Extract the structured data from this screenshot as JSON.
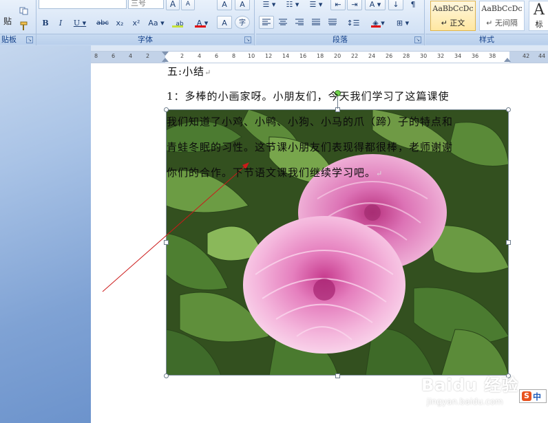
{
  "ribbon": {
    "groups": {
      "clipboard": "贴板",
      "font": "字体",
      "paragraph": "段落",
      "styles": "样式"
    },
    "clipboard": {
      "paste_label": "贴"
    },
    "font": {
      "size_value": "三号",
      "bold": "B",
      "italic": "I",
      "underline": "U",
      "strikethrough": "abc",
      "subscript": "x₂",
      "superscript": "x²",
      "change_case": "Aa",
      "grow_font": "A",
      "shrink_font": "A",
      "clear_format": "A",
      "char_border": "A",
      "phonetic": "ab",
      "font_color": "A",
      "char_shading": "A",
      "enclose_char": "字"
    },
    "styles": [
      {
        "sample": "AaBbCcDc",
        "name": "↵ 正文"
      },
      {
        "sample": "AaBbCcDc",
        "name": "↵ 无间隔"
      },
      {
        "sample": "A",
        "name": "标"
      }
    ]
  },
  "ruler": {
    "labels_left": [
      "8",
      "6",
      "4",
      "2"
    ],
    "labels_right": [
      "2",
      "4",
      "6",
      "8",
      "10",
      "12",
      "14",
      "16",
      "18",
      "20",
      "22",
      "24",
      "26",
      "28",
      "30",
      "32",
      "34",
      "36",
      "38",
      "42",
      "44"
    ]
  },
  "document": {
    "heading": "五:小结",
    "lines": [
      "1：多棒的小画家呀。小朋友们，今天我们学习了这篇课使",
      "我们知道了小鸡、小鸭、小狗、小马的爪（蹄）子的特点和",
      "青蛙冬眠的习性。这节课小朋友们表现得都很棒，老师谢谢",
      "你们的合作。下节语文课我们继续学习吧。"
    ],
    "paragraph_mark": "↵"
  },
  "picture": {
    "description": "peony-photo"
  },
  "watermark": {
    "brand": "Baidu 经验",
    "url": "jingyan.baidu.com"
  },
  "ime": {
    "logo": "S",
    "mode": "中"
  },
  "colors": {
    "ribbon_bg": "#d3e2f5",
    "group_label": "#15428b",
    "font_color_bar": "#e00000",
    "highlight_bar": "#c6e23a",
    "peony_pink": "#e58ac4",
    "leaf_green": "#3f6b2a"
  }
}
